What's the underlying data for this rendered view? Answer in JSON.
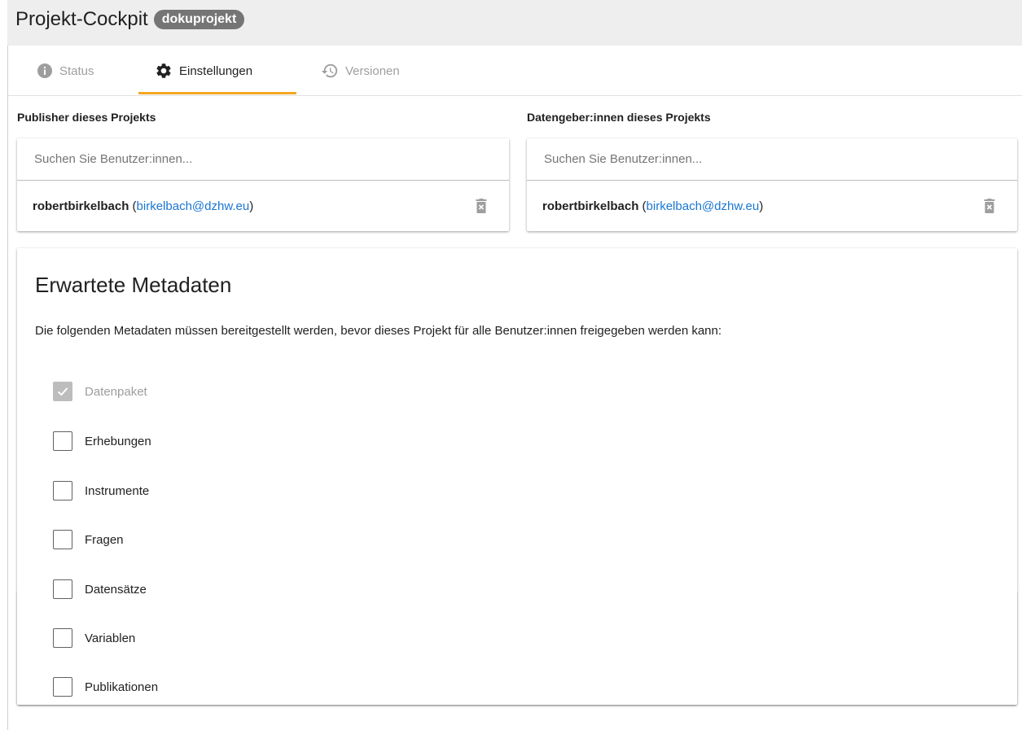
{
  "header": {
    "title": "Projekt-Cockpit",
    "project_chip": "dokuprojekt"
  },
  "tabs": [
    {
      "label": "Status",
      "icon": "info-icon",
      "active": false
    },
    {
      "label": "Einstellungen",
      "icon": "gear-icon",
      "active": true
    },
    {
      "label": "Versionen",
      "icon": "history-icon",
      "active": false
    }
  ],
  "publishers": {
    "label": "Publisher dieses Projekts",
    "search_placeholder": "Suchen Sie Benutzer:innen...",
    "users": [
      {
        "name": "robertbirkelbach",
        "email": "birkelbach@dzhw.eu"
      }
    ]
  },
  "data_providers": {
    "label": "Datengeber:innen dieses Projekts",
    "search_placeholder": "Suchen Sie Benutzer:innen...",
    "users": [
      {
        "name": "robertbirkelbach",
        "email": "birkelbach@dzhw.eu"
      }
    ]
  },
  "metadata": {
    "title": "Erwartete Metadaten",
    "description": "Die folgenden Metadaten müssen bereitgestellt werden, bevor dieses Projekt für alle Benutzer:innen freigegeben werden kann:",
    "items": [
      {
        "label": "Datenpaket",
        "checked": true,
        "disabled": true
      },
      {
        "label": "Erhebungen",
        "checked": false,
        "disabled": false
      },
      {
        "label": "Instrumente",
        "checked": false,
        "disabled": false
      },
      {
        "label": "Fragen",
        "checked": false,
        "disabled": false
      },
      {
        "label": "Datensätze",
        "checked": false,
        "disabled": false
      },
      {
        "label": "Variablen",
        "checked": false,
        "disabled": false
      },
      {
        "label": "Publikationen",
        "checked": false,
        "disabled": false
      }
    ]
  },
  "colors": {
    "accent": "#f5a623",
    "link": "#1976d2",
    "chip": "#757575"
  }
}
